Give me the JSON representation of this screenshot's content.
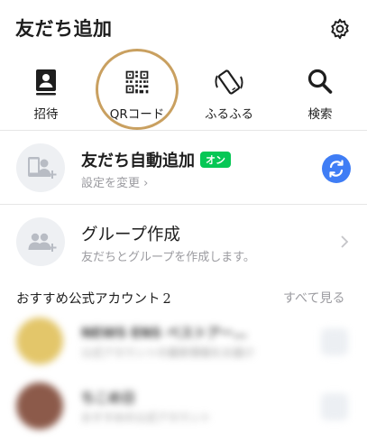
{
  "header": {
    "title": "友だち追加",
    "settings_icon": "gear-icon"
  },
  "actions": [
    {
      "label": "招待",
      "icon": "contact-book-icon"
    },
    {
      "label": "QRコード",
      "icon": "qr-code-icon"
    },
    {
      "label": "ふるふる",
      "icon": "shake-phone-icon"
    },
    {
      "label": "検索",
      "icon": "search-icon"
    }
  ],
  "rows": {
    "auto_add": {
      "title": "友だち自動追加",
      "badge": "オン",
      "subtitle": "設定を変更 ›",
      "icon": "phone-add-friend-icon",
      "action_icon": "sync-icon"
    },
    "group": {
      "title": "グループ作成",
      "subtitle": "友だちとグループを作成します。",
      "icon": "group-add-icon",
      "action_icon": "chevron-right-icon"
    }
  },
  "recommended": {
    "title": "おすすめ公式アカウント",
    "count": "2",
    "see_all": "すべて見る",
    "items": [
      {
        "name": "NEWS ENS ベストアー…",
        "desc": "公式アカウントの最新情報をお届け"
      },
      {
        "name": "ちこめ日",
        "desc": "おすすめの公式アカウント"
      }
    ]
  },
  "colors": {
    "accent_green": "#06c755",
    "accent_blue": "#3f7df5",
    "highlight_circle": "#c9a060",
    "muted_text": "#9b9ba0"
  }
}
